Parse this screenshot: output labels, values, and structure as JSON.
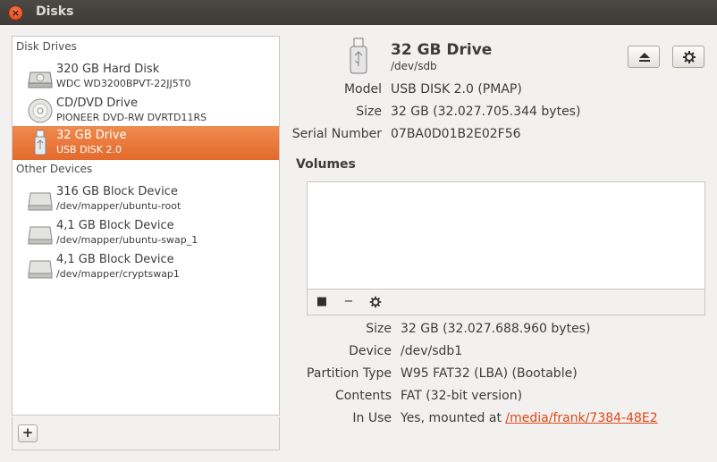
{
  "window": {
    "title": "Disks"
  },
  "sidebar": {
    "disk_drives_header": "Disk Drives",
    "other_devices_header": "Other Devices",
    "disk_drives": [
      {
        "name": "320 GB Hard Disk",
        "sub": "WDC WD3200BPVT-22JJ5T0",
        "icon": "hard-disk-icon"
      },
      {
        "name": "CD/DVD Drive",
        "sub": "PIONEER DVD-RW DVRTD11RS",
        "icon": "optical-disc-icon"
      },
      {
        "name": "32 GB Drive",
        "sub": "USB DISK 2.0",
        "icon": "usb-drive-icon",
        "selected": true
      }
    ],
    "other_devices": [
      {
        "name": "316 GB Block Device",
        "sub": "/dev/mapper/ubuntu-root",
        "icon": "block-device-icon"
      },
      {
        "name": "4,1 GB Block Device",
        "sub": "/dev/mapper/ubuntu-swap_1",
        "icon": "block-device-icon"
      },
      {
        "name": "4,1 GB Block Device",
        "sub": "/dev/mapper/cryptswap1",
        "icon": "block-device-icon"
      }
    ],
    "add_label": "+"
  },
  "drive": {
    "title": "32 GB Drive",
    "path": "/dev/sdb",
    "model_label": "Model",
    "model": "USB DISK 2.0 (PMAP)",
    "size_label": "Size",
    "size": "32 GB (32.027.705.344 bytes)",
    "serial_label": "Serial Number",
    "serial": "07BA0D01B2E02F56"
  },
  "volumes": {
    "title": "Volumes",
    "size_label": "Size",
    "size": "32 GB (32.027.688.960 bytes)",
    "device_label": "Device",
    "device": "/dev/sdb1",
    "partition_type_label": "Partition Type",
    "partition_type": "W95 FAT32 (LBA) (Bootable)",
    "contents_label": "Contents",
    "contents": "FAT (32-bit version)",
    "in_use_label": "In Use",
    "in_use_prefix": "Yes, mounted at ",
    "mount_point": "/media/frank/7384-48E2"
  },
  "colors": {
    "accent": "#e9753a",
    "link": "#dd4814"
  }
}
